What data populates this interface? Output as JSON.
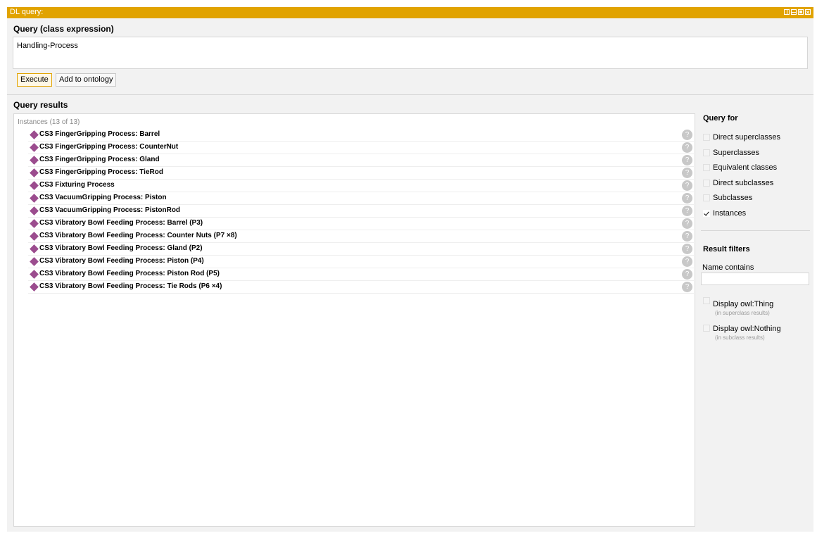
{
  "titlebar": {
    "title": "DL query:"
  },
  "query": {
    "section_title": "Query (class expression)",
    "expression": "Handling-Process",
    "execute_label": "Execute",
    "add_label": "Add to ontology"
  },
  "results": {
    "section_title": "Query results",
    "header": "Instances (13 of 13)",
    "items": [
      "CS3 FingerGripping Process: Barrel",
      "CS3 FingerGripping Process: CounterNut",
      "CS3 FingerGripping Process: Gland",
      "CS3 FingerGripping Process: TieRod",
      "CS3 Fixturing Process",
      "CS3 VacuumGripping Process: Piston",
      "CS3 VacuumGripping Process: PistonRod",
      "CS3 Vibratory Bowl Feeding Process: Barrel (P3)",
      "CS3 Vibratory Bowl Feeding Process: Counter Nuts (P7 ×8)",
      "CS3 Vibratory Bowl Feeding Process: Gland (P2)",
      "CS3 Vibratory Bowl Feeding Process: Piston (P4)",
      "CS3 Vibratory Bowl Feeding Process: Piston Rod (P5)",
      "CS3 Vibratory Bowl Feeding Process: Tie Rods (P6 ×4)"
    ],
    "help_glyph": "?"
  },
  "query_for": {
    "title": "Query for",
    "options": [
      {
        "label": "Direct superclasses",
        "checked": false
      },
      {
        "label": "Superclasses",
        "checked": false
      },
      {
        "label": "Equivalent classes",
        "checked": false
      },
      {
        "label": "Direct subclasses",
        "checked": false
      },
      {
        "label": "Subclasses",
        "checked": false
      },
      {
        "label": "Instances",
        "checked": true
      }
    ]
  },
  "filters": {
    "title": "Result filters",
    "name_contains_label": "Name contains",
    "name_contains_value": "",
    "owl_thing_label": "Display owl:Thing",
    "owl_thing_note": "(in superclass results)",
    "owl_thing_checked": false,
    "owl_nothing_label": "Display owl:Nothing",
    "owl_nothing_note": "(in subclass results)",
    "owl_nothing_checked": false
  },
  "colors": {
    "titlebar": "#e1a300",
    "instance_icon": "#9b4c8e"
  },
  "icons": {
    "instance": "diamond-icon",
    "help": "help-icon"
  }
}
